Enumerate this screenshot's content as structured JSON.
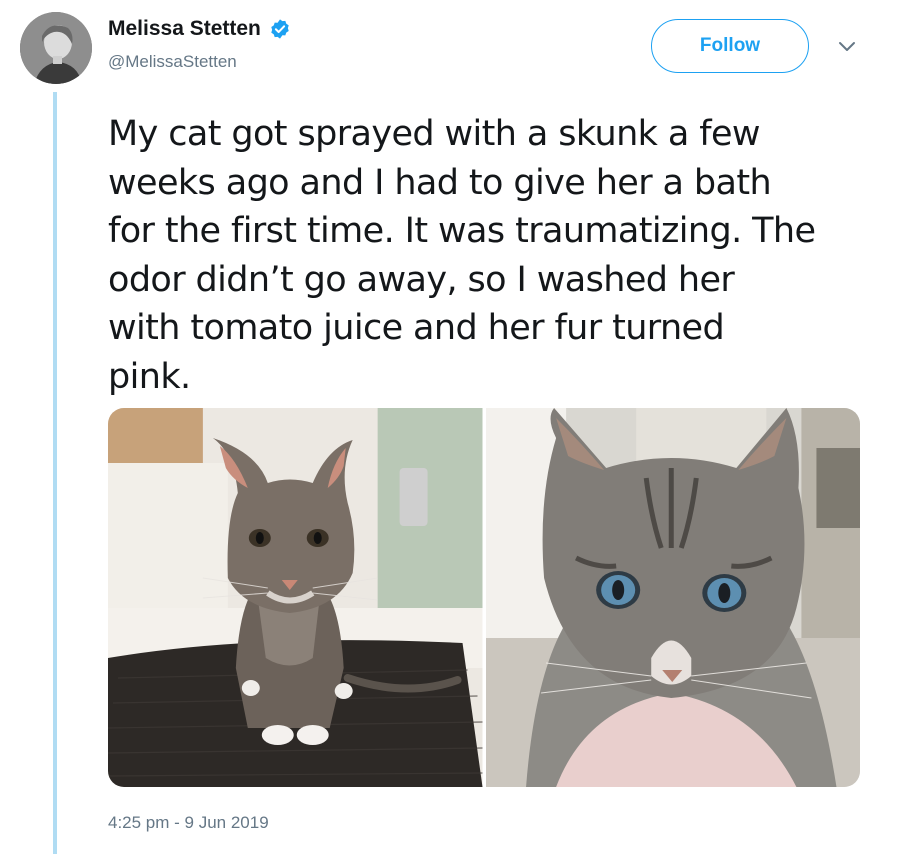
{
  "author": {
    "display_name": "Melissa Stetten",
    "handle": "@MelissaStetten",
    "verified": true
  },
  "actions": {
    "follow_label": "Follow",
    "more_icon": "chevron-down-icon"
  },
  "tweet": {
    "text": "My cat got sprayed with a skunk a few\nweeks ago and I had to give her a bath\nfor the first time. It was traumatizing. The\nodor didn’t go away, so I washed her\nwith tomato juice and her fur turned\npink.",
    "timestamp": "4:25 pm - 9 Jun 2019"
  },
  "colors": {
    "accent": "#1da1f2",
    "thread_line": "#b0dcf3",
    "secondary_text": "#657786",
    "primary_text": "#14171a"
  }
}
